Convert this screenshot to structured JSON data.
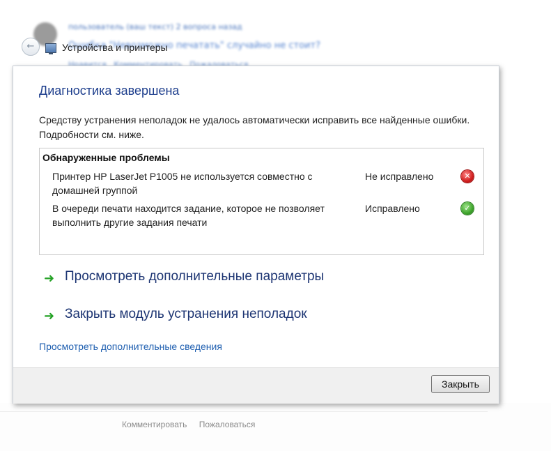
{
  "background": {
    "username": "пользователь (ваш текст) 2 вопроса назад",
    "question": "Ошибка \"Невозможно печатать\" случайно не стоит?",
    "actions": [
      "Нравится",
      "Комментировать",
      "Пожаловаться"
    ],
    "bottom_actions": [
      "Комментировать",
      "Пожаловаться"
    ]
  },
  "window": {
    "title": "Устройства и принтеры",
    "back_icon": "back-arrow-icon",
    "title_icon": "devices-and-printers-icon"
  },
  "dialog": {
    "heading": "Диагностика завершена",
    "summary": "Средству устранения неполадок не удалось автоматически исправить все найденные ошибки. Подробности см. ниже.",
    "problems_header": "Обнаруженные проблемы",
    "problems": [
      {
        "description": "Принтер HP LaserJet P1005 не используется совместно с домашней группой",
        "status": "Не исправлено",
        "icon": "error-icon",
        "icon_color": "#d11f1f"
      },
      {
        "description": "В очереди печати находится задание, которое не позволяет выполнить другие задания печати",
        "status": "Исправлено",
        "icon": "check-icon",
        "icon_color": "#3fa52c"
      }
    ],
    "links": {
      "view_more_options": "Просмотреть дополнительные параметры",
      "close_troubleshooter": "Закрыть модуль устранения неполадок",
      "more_info": "Просмотреть дополнительные сведения"
    },
    "close_button": "Закрыть"
  },
  "colors": {
    "heading": "#1c3d8c",
    "link": "#1f5fb0",
    "arrow": "#25a226"
  }
}
